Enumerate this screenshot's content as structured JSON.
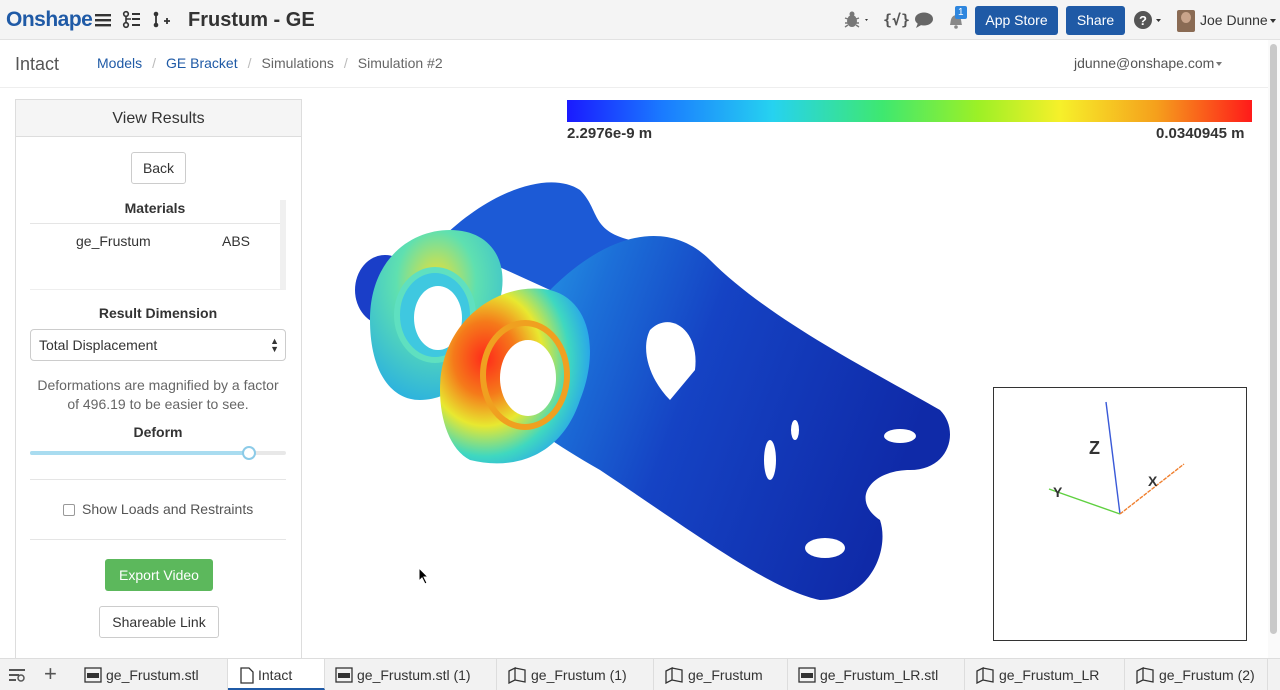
{
  "topbar": {
    "logo": "Onshape",
    "doc_title": "Frustum - GE",
    "notification_count": "1",
    "app_store_label": "App Store",
    "share_label": "Share",
    "user_name": "Joe Dunne",
    "icons": [
      "menu-icon",
      "versions-icon",
      "branch-icon",
      "bug-icon",
      "code-icon",
      "chat-icon",
      "bell-icon",
      "help-icon"
    ]
  },
  "breadcrumb": {
    "workspace": "Intact",
    "items": [
      "Models",
      "GE Bracket",
      "Simulations",
      "Simulation #2"
    ],
    "email": "jdunne@onshape.com"
  },
  "panel": {
    "title": "View Results",
    "back_label": "Back",
    "materials_title": "Materials",
    "materials": [
      {
        "part": "ge_Frustum",
        "material": "ABS"
      }
    ],
    "result_dimension_label": "Result Dimension",
    "result_dimension_value": "Total Displacement",
    "note": "Deformations are magnified by a factor of 496.19 to be easier to see.",
    "deform_label": "Deform",
    "deform_level": 0.855,
    "show_loads_label": "Show Loads and Restraints",
    "show_loads_checked": false,
    "export_video_label": "Export Video",
    "shareable_link_label": "Shareable Link"
  },
  "viewport": {
    "scale_min": "2.2976e-9 m",
    "scale_max": "0.0340945 m",
    "triad": {
      "x": "X",
      "y": "Y",
      "z": "Z"
    }
  },
  "tabs": [
    {
      "label": "ge_Frustum.stl",
      "icon": "stl-icon",
      "active": false
    },
    {
      "label": "Intact",
      "icon": "document-icon",
      "active": true
    },
    {
      "label": "ge_Frustum.stl (1)",
      "icon": "stl-icon",
      "active": false
    },
    {
      "label": "ge_Frustum (1)",
      "icon": "part-studio-icon",
      "active": false
    },
    {
      "label": "ge_Frustum",
      "icon": "part-studio-icon",
      "active": false
    },
    {
      "label": "ge_Frustum_LR.stl",
      "icon": "stl-icon",
      "active": false
    },
    {
      "label": "ge_Frustum_LR",
      "icon": "part-studio-icon",
      "active": false
    },
    {
      "label": "ge_Frustum (2)",
      "icon": "part-studio-icon",
      "active": false
    }
  ],
  "colors": {
    "brand": "#1f5aa6",
    "export_green": "#5cb85c",
    "slider": "#8ccbe8"
  }
}
